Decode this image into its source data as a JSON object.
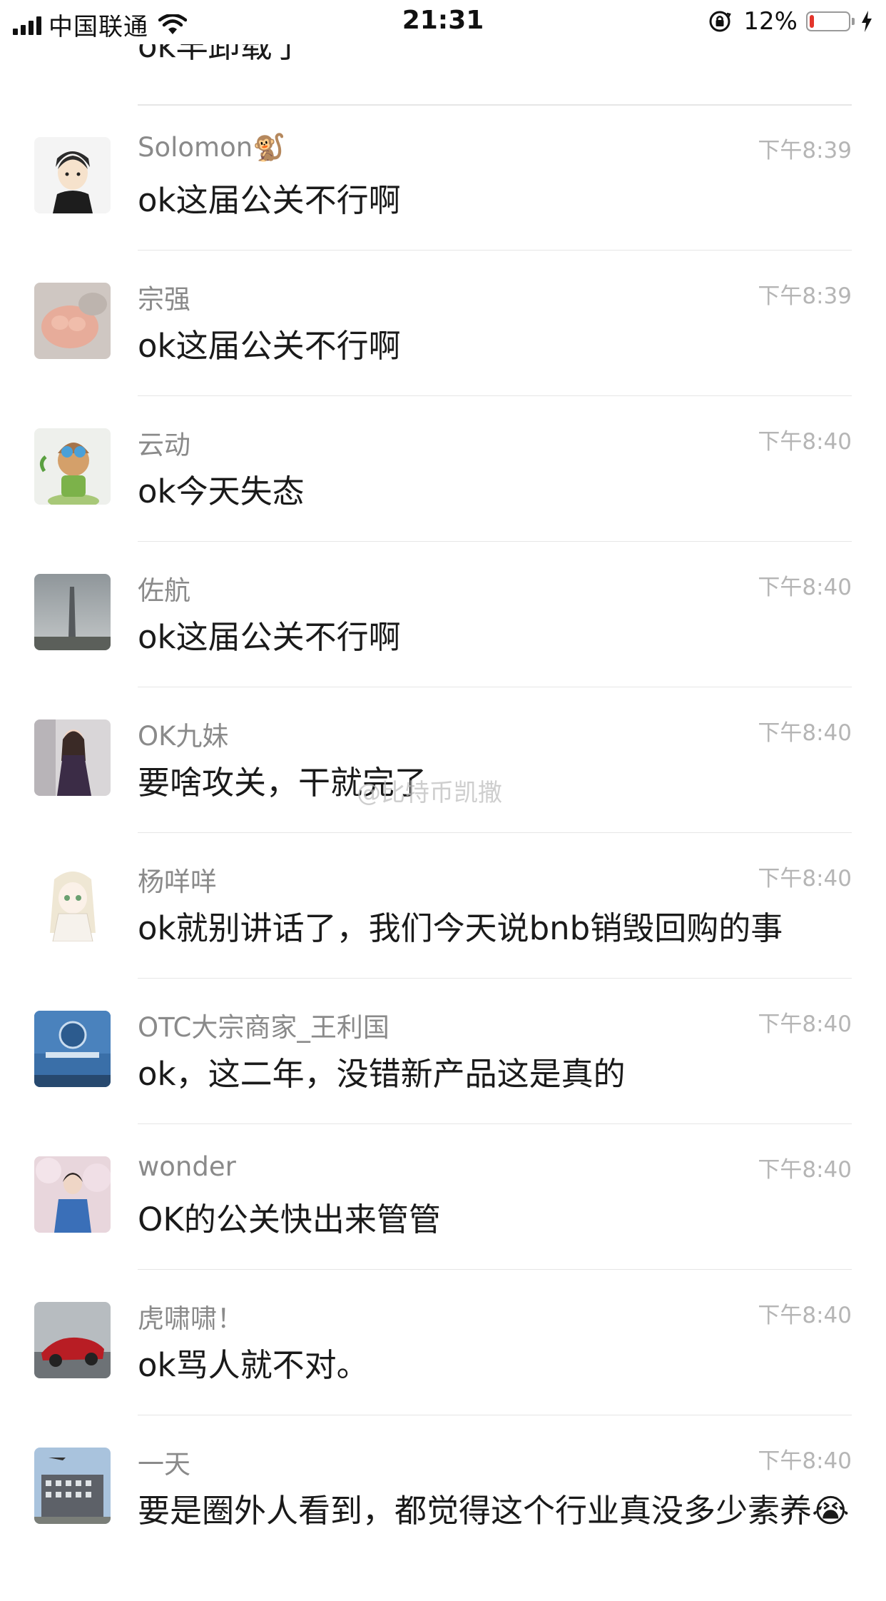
{
  "status_bar": {
    "carrier": "中国联通",
    "time": "21:31",
    "battery_percent_text": "12%",
    "battery_level": 0.12,
    "battery_color": "#e3352b"
  },
  "partial_message": {
    "text": "ok早卸载了"
  },
  "messages": [
    {
      "name": "Solomon🐒",
      "time": "下午8:39",
      "text": "ok这届公关不行啊"
    },
    {
      "name": "宗强",
      "time": "下午8:39",
      "text": "ok这届公关不行啊"
    },
    {
      "name": "云动",
      "time": "下午8:40",
      "text": "ok今天失态"
    },
    {
      "name": "佐航",
      "time": "下午8:40",
      "text": "ok这届公关不行啊"
    },
    {
      "name": "OK九妹",
      "time": "下午8:40",
      "text": "要啥攻关，干就完了"
    },
    {
      "name": "杨咩咩",
      "time": "下午8:40",
      "text": "ok就别讲话了，我们今天说bnb销毁回购的事"
    },
    {
      "name": "OTC大宗商家_王利国",
      "time": "下午8:40",
      "text": "ok，这二年，没错新产品这是真的"
    },
    {
      "name": "wonder",
      "time": "下午8:40",
      "text": "OK的公关快出来管管"
    },
    {
      "name": "虎啸啸！",
      "time": "下午8:40",
      "text": "ok骂人就不对。"
    },
    {
      "name": "一天",
      "time": "下午8:40",
      "text": "要是圈外人看到，都觉得这个行业真没多少素养😭"
    }
  ],
  "watermark": "@比特币凯撒"
}
